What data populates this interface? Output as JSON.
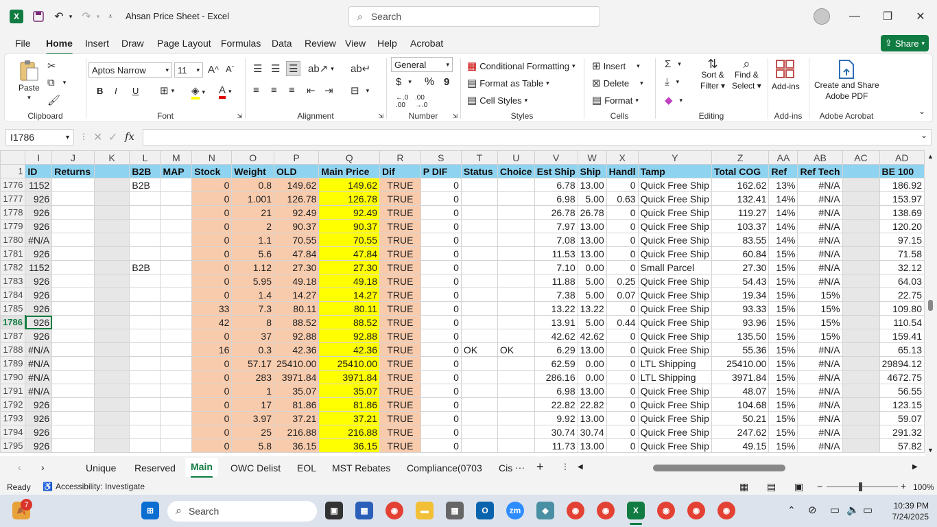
{
  "app": {
    "title": "Ahsan Price Sheet  -  Excel",
    "search_placeholder": "Search",
    "share_label": "Share"
  },
  "menu": [
    "File",
    "Home",
    "Insert",
    "Draw",
    "Page Layout",
    "Formulas",
    "Data",
    "Review",
    "View",
    "Help",
    "Acrobat"
  ],
  "ribbon": {
    "clipboard": {
      "paste": "Paste",
      "label": "Clipboard"
    },
    "font": {
      "name": "Aptos Narrow",
      "size": "11",
      "label": "Font",
      "bold": "B",
      "italic": "I",
      "underline": "U"
    },
    "alignment": {
      "label": "Alignment"
    },
    "number": {
      "format": "General",
      "label": "Number",
      "currency": "$",
      "percent": "%",
      "comma": "9"
    },
    "styles": {
      "conditional": "Conditional Formatting",
      "format_table": "Format as Table",
      "cell_styles": "Cell Styles",
      "label": "Styles"
    },
    "cells": {
      "insert": "Insert",
      "delete": "Delete",
      "format": "Format",
      "label": "Cells"
    },
    "editing": {
      "sort": "Sort &",
      "filter": "Filter",
      "find": "Find &",
      "select": "Select",
      "label": "Editing"
    },
    "addins": {
      "btn": "Add-ins",
      "label": "Add-ins"
    },
    "acrobat": {
      "line1": "Create and Share",
      "line2": "Adobe PDF",
      "label": "Adobe Acrobat"
    }
  },
  "formula_bar": {
    "name_box": "I1786",
    "fx": "fx",
    "formula": ""
  },
  "grid": {
    "col_letters": [
      "I",
      "J",
      "K",
      "L",
      "M",
      "N",
      "O",
      "P",
      "Q",
      "R",
      "S",
      "T",
      "U",
      "V",
      "W",
      "X",
      "Y",
      "Z",
      "AA",
      "AB",
      "AC",
      "AD"
    ],
    "header_row_num": "1",
    "headers": [
      "ID",
      "Returns",
      "",
      "B2B",
      "MAP",
      "Stock",
      "Weight",
      "OLD",
      "Main Price",
      "Dif",
      "P DIF",
      "Status",
      "Choice",
      "Est Ship",
      "Ship",
      "Handl",
      "Tamp",
      "Total COG",
      "Ref",
      "Ref Tech",
      "",
      "BE 100"
    ],
    "rows": [
      {
        "n": "1776",
        "c": [
          "1152",
          "",
          "",
          "B2B",
          "",
          "0",
          "0.8",
          "149.62",
          "149.62",
          "TRUE",
          "0",
          "",
          "",
          "6.78",
          "13.00",
          "0",
          "Quick Free Ship",
          "162.62",
          "13%",
          "#N/A",
          "",
          "186.92"
        ]
      },
      {
        "n": "1777",
        "c": [
          "926",
          "",
          "",
          "",
          "",
          "0",
          "1.001",
          "126.78",
          "126.78",
          "TRUE",
          "0",
          "",
          "",
          "6.98",
          "5.00",
          "0.63",
          "Quick Free Ship",
          "132.41",
          "14%",
          "#N/A",
          "",
          "153.97"
        ]
      },
      {
        "n": "1778",
        "c": [
          "926",
          "",
          "",
          "",
          "",
          "0",
          "21",
          "92.49",
          "92.49",
          "TRUE",
          "0",
          "",
          "",
          "26.78",
          "26.78",
          "0",
          "Quick Free Ship",
          "119.27",
          "14%",
          "#N/A",
          "",
          "138.69"
        ]
      },
      {
        "n": "1779",
        "c": [
          "926",
          "",
          "",
          "",
          "",
          "0",
          "2",
          "90.37",
          "90.37",
          "TRUE",
          "0",
          "",
          "",
          "7.97",
          "13.00",
          "0",
          "Quick Free Ship",
          "103.37",
          "14%",
          "#N/A",
          "",
          "120.20"
        ]
      },
      {
        "n": "1780",
        "c": [
          "#N/A",
          "",
          "",
          "",
          "",
          "0",
          "1.1",
          "70.55",
          "70.55",
          "TRUE",
          "0",
          "",
          "",
          "7.08",
          "13.00",
          "0",
          "Quick Free Ship",
          "83.55",
          "14%",
          "#N/A",
          "",
          "97.15"
        ]
      },
      {
        "n": "1781",
        "c": [
          "926",
          "",
          "",
          "",
          "",
          "0",
          "5.6",
          "47.84",
          "47.84",
          "TRUE",
          "0",
          "",
          "",
          "11.53",
          "13.00",
          "0",
          "Quick Free Ship",
          "60.84",
          "15%",
          "#N/A",
          "",
          "71.58"
        ]
      },
      {
        "n": "1782",
        "c": [
          "1152",
          "",
          "",
          "B2B",
          "",
          "0",
          "1.12",
          "27.30",
          "27.30",
          "TRUE",
          "0",
          "",
          "",
          "7.10",
          "0.00",
          "0",
          "Small Parcel",
          "27.30",
          "15%",
          "#N/A",
          "",
          "32.12"
        ]
      },
      {
        "n": "1783",
        "c": [
          "926",
          "",
          "",
          "",
          "",
          "0",
          "5.95",
          "49.18",
          "49.18",
          "TRUE",
          "0",
          "",
          "",
          "11.88",
          "5.00",
          "0.25",
          "Quick Free Ship",
          "54.43",
          "15%",
          "#N/A",
          "",
          "64.03"
        ]
      },
      {
        "n": "1784",
        "c": [
          "926",
          "",
          "",
          "",
          "",
          "0",
          "1.4",
          "14.27",
          "14.27",
          "TRUE",
          "0",
          "",
          "",
          "7.38",
          "5.00",
          "0.07",
          "Quick Free Ship",
          "19.34",
          "15%",
          "15%",
          "",
          "22.75"
        ]
      },
      {
        "n": "1785",
        "c": [
          "926",
          "",
          "",
          "",
          "",
          "33",
          "7.3",
          "80.11",
          "80.11",
          "TRUE",
          "0",
          "",
          "",
          "13.22",
          "13.22",
          "0",
          "Quick Free Ship",
          "93.33",
          "15%",
          "15%",
          "",
          "109.80"
        ]
      },
      {
        "n": "1786",
        "c": [
          "926",
          "",
          "",
          "",
          "",
          "42",
          "8",
          "88.52",
          "88.52",
          "TRUE",
          "0",
          "",
          "",
          "13.91",
          "5.00",
          "0.44",
          "Quick Free Ship",
          "93.96",
          "15%",
          "15%",
          "",
          "110.54"
        ]
      },
      {
        "n": "1787",
        "c": [
          "926",
          "",
          "",
          "",
          "",
          "0",
          "37",
          "92.88",
          "92.88",
          "TRUE",
          "0",
          "",
          "",
          "42.62",
          "42.62",
          "0",
          "Quick Free Ship",
          "135.50",
          "15%",
          "15%",
          "",
          "159.41"
        ]
      },
      {
        "n": "1788",
        "c": [
          "#N/A",
          "",
          "",
          "",
          "",
          "16",
          "0.3",
          "42.36",
          "42.36",
          "TRUE",
          "0",
          "OK",
          "OK",
          "6.29",
          "13.00",
          "0",
          "Quick Free Ship",
          "55.36",
          "15%",
          "#N/A",
          "",
          "65.13"
        ]
      },
      {
        "n": "1789",
        "c": [
          "#N/A",
          "",
          "",
          "",
          "",
          "0",
          "57.17",
          "25410.00",
          "25410.00",
          "TRUE",
          "0",
          "",
          "",
          "62.59",
          "0.00",
          "0",
          "LTL Shipping",
          "25410.00",
          "15%",
          "#N/A",
          "",
          "29894.12"
        ]
      },
      {
        "n": "1790",
        "c": [
          "#N/A",
          "",
          "",
          "",
          "",
          "0",
          "283",
          "3971.84",
          "3971.84",
          "TRUE",
          "0",
          "",
          "",
          "286.16",
          "0.00",
          "0",
          "LTL Shipping",
          "3971.84",
          "15%",
          "#N/A",
          "",
          "4672.75"
        ]
      },
      {
        "n": "1791",
        "c": [
          "#N/A",
          "",
          "",
          "",
          "",
          "0",
          "1",
          "35.07",
          "35.07",
          "TRUE",
          "0",
          "",
          "",
          "6.98",
          "13.00",
          "0",
          "Quick Free Ship",
          "48.07",
          "15%",
          "#N/A",
          "",
          "56.55"
        ]
      },
      {
        "n": "1792",
        "c": [
          "926",
          "",
          "",
          "",
          "",
          "0",
          "17",
          "81.86",
          "81.86",
          "TRUE",
          "0",
          "",
          "",
          "22.82",
          "22.82",
          "0",
          "Quick Free Ship",
          "104.68",
          "15%",
          "#N/A",
          "",
          "123.15"
        ]
      },
      {
        "n": "1793",
        "c": [
          "926",
          "",
          "",
          "",
          "",
          "0",
          "3.97",
          "37.21",
          "37.21",
          "TRUE",
          "0",
          "",
          "",
          "9.92",
          "13.00",
          "0",
          "Quick Free Ship",
          "50.21",
          "15%",
          "#N/A",
          "",
          "59.07"
        ]
      },
      {
        "n": "1794",
        "c": [
          "926",
          "",
          "",
          "",
          "",
          "0",
          "25",
          "216.88",
          "216.88",
          "TRUE",
          "0",
          "",
          "",
          "30.74",
          "30.74",
          "0",
          "Quick Free Ship",
          "247.62",
          "15%",
          "#N/A",
          "",
          "291.32"
        ]
      },
      {
        "n": "1795",
        "c": [
          "926",
          "",
          "",
          "",
          "",
          "0",
          "5.8",
          "36.15",
          "36.15",
          "TRUE",
          "0",
          "",
          "",
          "11.73",
          "13.00",
          "0",
          "Quick Free Ship",
          "49.15",
          "15%",
          "#N/A",
          "",
          "57.82"
        ]
      }
    ],
    "selected_row": "1786"
  },
  "sheet_tabs": [
    "Unique",
    "Reserved",
    "Main",
    "OWC Delist",
    "EOL",
    "MST Rebates",
    "Compliance(0703",
    "Cis"
  ],
  "active_tab": "Main",
  "status": {
    "ready": "Ready",
    "accessibility": "Accessibility: Investigate",
    "zoom": "100%"
  },
  "taskbar": {
    "search": "Search",
    "time": "10:39 PM",
    "date": "7/24/2025",
    "badge": "7"
  },
  "colors": {
    "excel_green": "#107c41",
    "header_blue": "#8ed3f0",
    "salmon": "#f8cbad",
    "yellow": "#ffff00"
  }
}
